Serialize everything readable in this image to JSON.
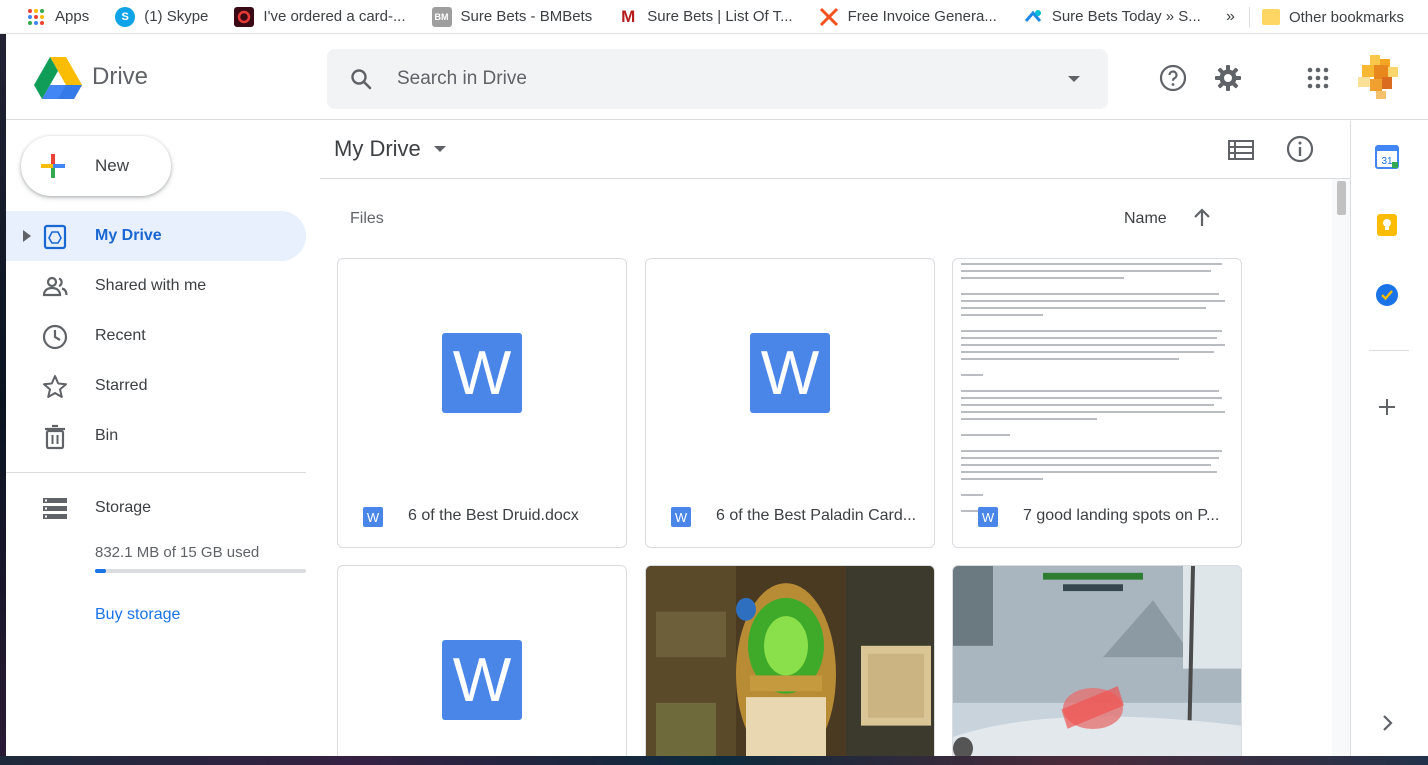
{
  "bookmarks": {
    "items": [
      {
        "label": "Apps",
        "icon": "apps-grid-icon"
      },
      {
        "label": "(1) Skype",
        "icon": "skype-icon"
      },
      {
        "label": "I've ordered a card-...",
        "icon": "site-favicon-icon"
      },
      {
        "label": "Sure Bets - BMBets",
        "icon": "bmbets-icon"
      },
      {
        "label": "Sure Bets | List Of T...",
        "icon": "m-favicon-icon"
      },
      {
        "label": "Free Invoice Genera...",
        "icon": "invoice-favicon-icon"
      },
      {
        "label": "Sure Bets Today » S...",
        "icon": "surebets-favicon-icon"
      }
    ],
    "overflow": "»",
    "other_label": "Other bookmarks"
  },
  "header": {
    "brand": "Drive",
    "search_placeholder": "Search in Drive"
  },
  "sidebar": {
    "new_label": "New",
    "items": [
      {
        "label": "My Drive",
        "icon": "my-drive-icon",
        "active": true
      },
      {
        "label": "Shared with me",
        "icon": "people-icon"
      },
      {
        "label": "Recent",
        "icon": "clock-icon"
      },
      {
        "label": "Starred",
        "icon": "star-icon"
      },
      {
        "label": "Bin",
        "icon": "trash-icon"
      }
    ],
    "storage": {
      "label": "Storage",
      "used_text": "832.1 MB of 15 GB used",
      "used_fraction": 0.054,
      "buy_label": "Buy storage"
    }
  },
  "main": {
    "title": "My Drive",
    "section_label": "Files",
    "sort_label": "Name",
    "files": [
      {
        "name": "6 of the Best Druid.docx",
        "type": "word"
      },
      {
        "name": "6 of the Best Paladin Card...",
        "type": "word"
      },
      {
        "name": "7 good landing spots on P...",
        "type": "word-preview"
      },
      {
        "name": "",
        "type": "word"
      },
      {
        "name": "",
        "type": "image-hearthstone"
      },
      {
        "name": "",
        "type": "image-tanks"
      }
    ],
    "word_glyph": "W"
  },
  "right_panel": {
    "calendar_day": "31"
  },
  "colors": {
    "accent": "#1a73e8",
    "active_bg": "#e8f0fe",
    "word_blue": "#4a86e8"
  }
}
